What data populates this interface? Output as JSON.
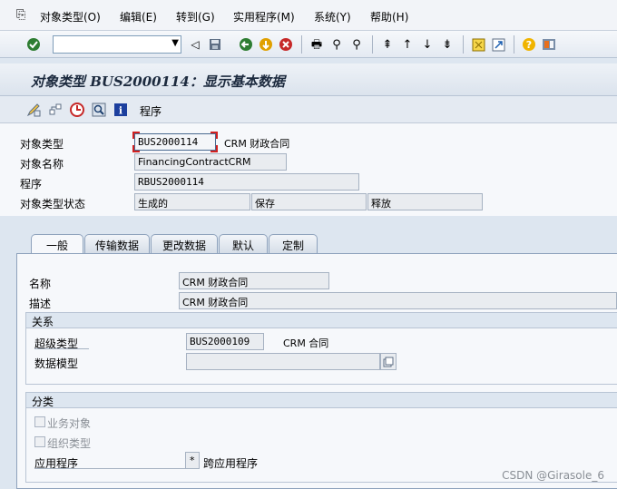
{
  "menubar": {
    "items": [
      "对象类型(O)",
      "编辑(E)",
      "转到(G)",
      "实用程序(M)",
      "系统(Y)",
      "帮助(H)"
    ]
  },
  "toolbar": {
    "command_value": ""
  },
  "title": "对象类型 BUS2000114：显示基本数据",
  "app_toolbar": {
    "program_label": "程序"
  },
  "header": {
    "object_type_label": "对象类型",
    "object_type_value": "BUS2000114",
    "object_type_desc": "CRM 财政合同",
    "object_name_label": "对象名称",
    "object_name_value": "FinancingContractCRM",
    "program_label": "程序",
    "program_value": "RBUS2000114",
    "status_label": "对象类型状态",
    "status_values": [
      "生成的",
      "保存",
      "释放"
    ]
  },
  "tabs": [
    "一般",
    "传输数据",
    "更改数据",
    "默认",
    "定制"
  ],
  "general": {
    "name_label": "名称",
    "name_value": "CRM 财政合同",
    "desc_label": "描述",
    "desc_value": "CRM 财政合同"
  },
  "relations": {
    "title": "关系",
    "supertype_label": "超级类型",
    "supertype_value": "BUS2000109",
    "supertype_desc": "CRM 合同",
    "datamodel_label": "数据模型",
    "datamodel_value": ""
  },
  "classification": {
    "title": "分类",
    "business_object_label": "业务对象",
    "org_type_label": "组织类型",
    "application_label": "应用程序",
    "application_value": "*",
    "application_desc": "跨应用程序"
  },
  "watermark": "CSDN @Girasole_6"
}
